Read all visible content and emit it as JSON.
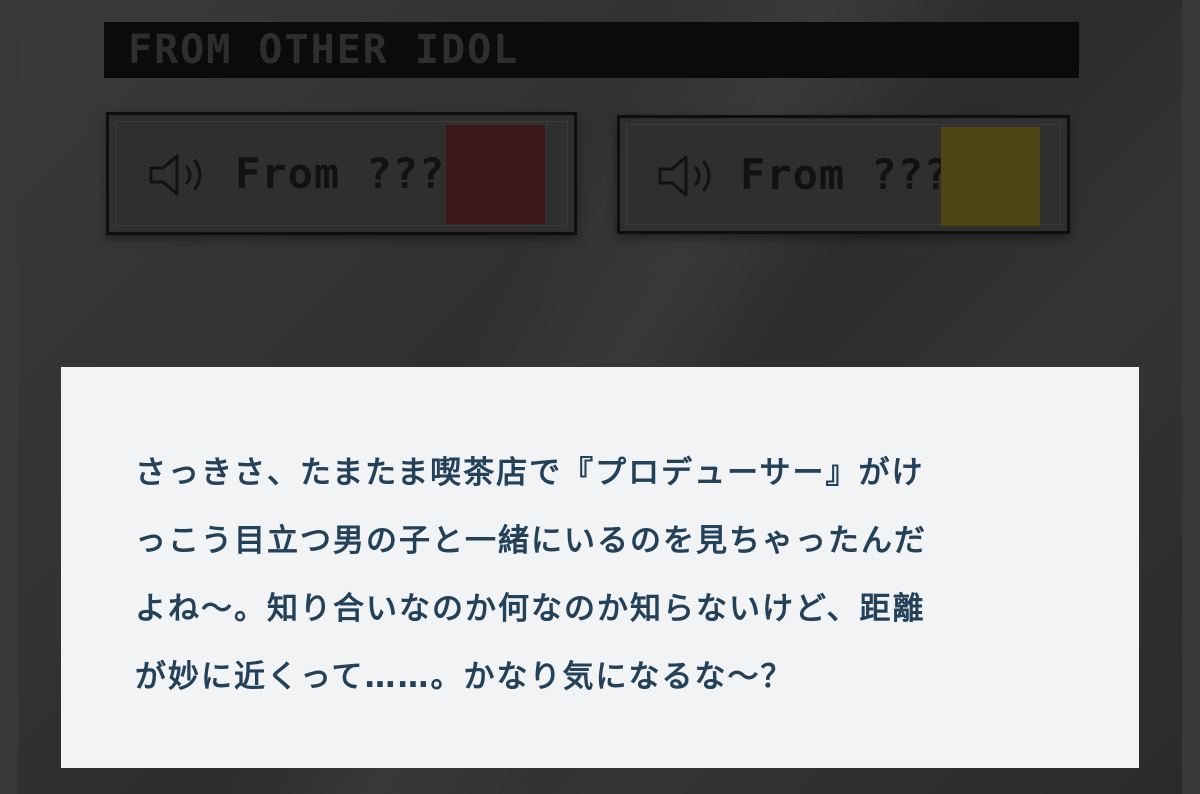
{
  "section": {
    "title": "FROM OTHER IDOL"
  },
  "voice_buttons": [
    {
      "label": "From ???",
      "icon": "speaker-icon",
      "portrait_color": "#3c1818"
    },
    {
      "label": "From ???",
      "icon": "speaker-icon",
      "portrait_color": "#4f4514"
    }
  ],
  "dialog": {
    "lines": [
      "さっきさ、たまたま喫茶店で『プロデューサー』がけ",
      "っこう目立つ男の子と一緒にいるのを見ちゃったんだ",
      "よね～。知り合いなのか何なのか知らないけど、距離",
      "が妙に近くって……。かなり気になるな～？"
    ]
  },
  "colors": {
    "dialog_text": "#24415a",
    "dialog_bg": "#f2f3f4",
    "header_bg": "#0b0b0b"
  }
}
